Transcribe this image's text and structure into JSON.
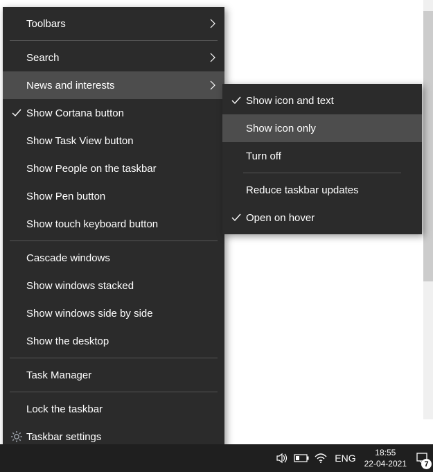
{
  "mainMenu": {
    "toolbars": "Toolbars",
    "search": "Search",
    "newsInterests": "News and interests",
    "showCortana": "Show Cortana button",
    "showTaskView": "Show Task View button",
    "showPeople": "Show People on the taskbar",
    "showPen": "Show Pen button",
    "showTouchKb": "Show touch keyboard button",
    "cascade": "Cascade windows",
    "stacked": "Show windows stacked",
    "sideBySide": "Show windows side by side",
    "showDesktop": "Show the desktop",
    "taskManager": "Task Manager",
    "lockTaskbar": "Lock the taskbar",
    "taskbarSettings": "Taskbar settings"
  },
  "subMenu": {
    "showIconText": "Show icon and text",
    "showIconOnly": "Show icon only",
    "turnOff": "Turn off",
    "reduceUpdates": "Reduce taskbar updates",
    "openHover": "Open on hover"
  },
  "tray": {
    "lang": "ENG",
    "time": "18:55",
    "date": "22-04-2021",
    "badge": "7"
  }
}
